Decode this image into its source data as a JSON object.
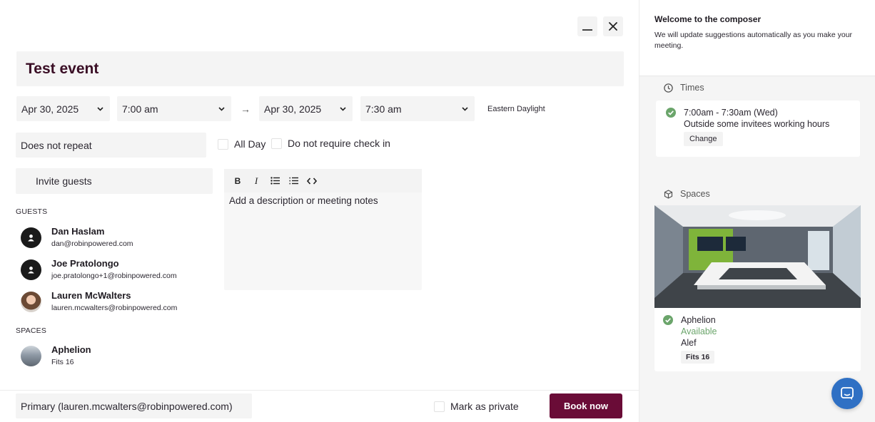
{
  "composer": {
    "title": "Test event",
    "start_date": "Apr 30, 2025",
    "start_time": "7:00 am",
    "arrow": "→",
    "end_date": "Apr 30, 2025",
    "end_time": "7:30 am",
    "timezone": "Eastern Daylight",
    "repeat": "Does not repeat",
    "all_day_label": "All Day",
    "no_checkin_label": "Do not require check in",
    "invite_placeholder": "Invite guests",
    "guests_label": "GUESTS",
    "guests": [
      {
        "name": "Dan Haslam",
        "email": "dan@robinpowered.com"
      },
      {
        "name": "Joe Pratolongo",
        "email": "joe.pratolongo+1@robinpowered.com"
      },
      {
        "name": "Lauren McWalters",
        "email": "lauren.mcwalters@robinpowered.com"
      }
    ],
    "spaces_label": "SPACES",
    "spaces": [
      {
        "name": "Aphelion",
        "capacity": "Fits 16"
      }
    ],
    "editor": {
      "placeholder": "Add a description or meeting notes",
      "bold": "B",
      "italic": "I"
    },
    "calendar": "Primary (lauren.mcwalters@robinpowered.com)",
    "private_label": "Mark as private",
    "book_label": "Book now"
  },
  "sidebar": {
    "welcome_title": "Welcome to the composer",
    "welcome_text": "We will update suggestions automatically as you make your meeting.",
    "times_heading": "Times",
    "time_suggestion": "7:00am - 7:30am (Wed)",
    "time_note": "Outside some invitees working hours",
    "change_label": "Change",
    "spaces_heading": "Spaces",
    "space_name": "Aphelion",
    "space_status": "Available",
    "space_building": "Alef",
    "space_capacity": "Fits 16"
  },
  "colors": {
    "brand": "#6a0c37",
    "success": "#6ba56b",
    "chat": "#2f70c4"
  }
}
